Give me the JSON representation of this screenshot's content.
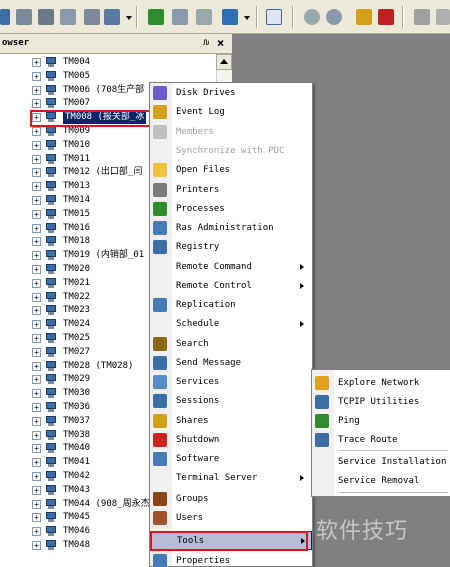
{
  "panel": {
    "title": "owser",
    "pin_glyph": "ԉ",
    "close_glyph": "×"
  },
  "tree": {
    "nodes": [
      {
        "text": "TM004"
      },
      {
        "text": "TM005"
      },
      {
        "text": "TM006 (708生产部"
      },
      {
        "text": "TM007"
      },
      {
        "text": "TM008 (报关部_冰",
        "selected": true
      },
      {
        "text": "TM009"
      },
      {
        "text": "TM010"
      },
      {
        "text": "TM011"
      },
      {
        "text": "TM012 (出口部_闫"
      },
      {
        "text": "TM013"
      },
      {
        "text": "TM014"
      },
      {
        "text": "TM015"
      },
      {
        "text": "TM016"
      },
      {
        "text": "TM018"
      },
      {
        "text": "TM019 (内销部_01"
      },
      {
        "text": "TM020"
      },
      {
        "text": "TM021"
      },
      {
        "text": "TM022"
      },
      {
        "text": "TM023"
      },
      {
        "text": "TM024"
      },
      {
        "text": "TM025"
      },
      {
        "text": "TM027"
      },
      {
        "text": "TM028 (TM028)"
      },
      {
        "text": "TM029"
      },
      {
        "text": "TM030"
      },
      {
        "text": "TM036"
      },
      {
        "text": "TM037"
      },
      {
        "text": "TM038"
      },
      {
        "text": "TM040"
      },
      {
        "text": "TM041"
      },
      {
        "text": "TM042"
      },
      {
        "text": "TM043"
      },
      {
        "text": "TM044 (908_周永杰"
      },
      {
        "text": "TM045"
      },
      {
        "text": "TM046"
      },
      {
        "text": "TM048"
      }
    ]
  },
  "menu": {
    "items": [
      {
        "label": "Disk Drives",
        "icon": "disk-drives-icon",
        "color": "#6a5acd"
      },
      {
        "label": "Event Log",
        "icon": "event-log-icon",
        "color": "#d4a017"
      },
      {
        "label": "Members",
        "icon": "members-icon",
        "color": "#c0c0c0",
        "disabled": true
      },
      {
        "label": "Synchronize with PDC",
        "disabled": true
      },
      {
        "label": "Open Files",
        "icon": "open-files-icon",
        "color": "#f0c040"
      },
      {
        "label": "Printers",
        "icon": "printers-icon",
        "color": "#7a7a7a"
      },
      {
        "label": "Processes",
        "icon": "processes-icon",
        "color": "#2e8b2e"
      },
      {
        "label": "Ras Administration",
        "icon": "ras-admin-icon",
        "color": "#4a7ab5"
      },
      {
        "label": "Registry",
        "icon": "registry-icon",
        "color": "#3a6ea5"
      },
      {
        "label": "Remote Command",
        "submenu": true
      },
      {
        "label": "Remote Control",
        "submenu": true
      },
      {
        "label": "Replication",
        "icon": "replication-icon",
        "color": "#4a7ab5"
      },
      {
        "label": "Schedule",
        "submenu": true
      },
      {
        "label": "Search",
        "icon": "search-icon",
        "color": "#8b6914"
      },
      {
        "label": "Send Message",
        "icon": "send-message-icon",
        "color": "#3a6ea5"
      },
      {
        "label": "Services",
        "icon": "services-icon",
        "color": "#5a8ac5"
      },
      {
        "label": "Sessions",
        "icon": "sessions-icon",
        "color": "#3a6ea5"
      },
      {
        "label": "Shares",
        "icon": "shares-icon",
        "color": "#d4a017"
      },
      {
        "label": "Shutdown",
        "icon": "shutdown-icon",
        "color": "#d02020"
      },
      {
        "label": "Software",
        "icon": "software-icon",
        "color": "#4a7ab5"
      },
      {
        "label": "Terminal Server",
        "submenu": true
      },
      {
        "label": "Groups",
        "icon": "groups-icon",
        "color": "#8b4513"
      },
      {
        "label": "Users",
        "icon": "users-icon",
        "color": "#a0522d"
      },
      {
        "label": "Tools",
        "submenu": true,
        "highlighted": true
      },
      {
        "label": "Properties",
        "icon": "properties-icon",
        "color": "#4a7ab5"
      }
    ]
  },
  "submenu": {
    "items": [
      {
        "label": "Explore Network",
        "icon": "explore-network-icon",
        "color": "#e0a020"
      },
      {
        "label": "TCPIP Utilities",
        "icon": "tcpip-icon",
        "color": "#3a6ea5"
      },
      {
        "label": "Ping",
        "icon": "ping-icon",
        "color": "#2e8b2e"
      },
      {
        "label": "Trace Route",
        "icon": "trace-route-icon",
        "color": "#3a6ea5"
      },
      {
        "label": "Service Installation"
      },
      {
        "label": "Service Removal"
      }
    ]
  },
  "watermark": "软件技巧",
  "colors": {
    "selection": "#0a246a",
    "highlight_box": "#e0141c",
    "menu_hover": "#b6bdd2"
  }
}
